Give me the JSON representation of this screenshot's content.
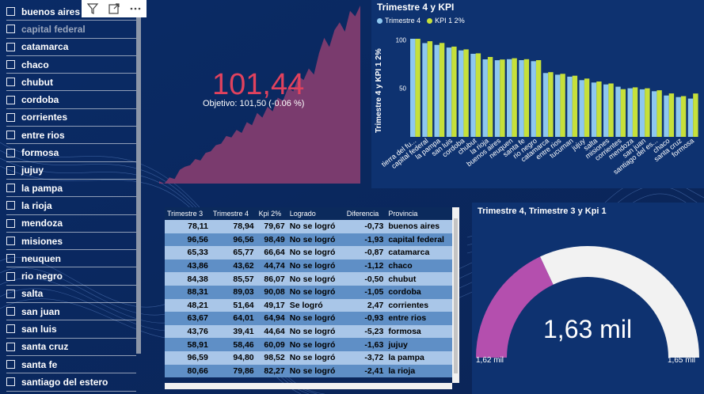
{
  "slicer": {
    "items": [
      {
        "label": "buenos aires",
        "dim": false
      },
      {
        "label": "capital federal",
        "dim": true
      },
      {
        "label": "catamarca",
        "dim": false
      },
      {
        "label": "chaco",
        "dim": false
      },
      {
        "label": "chubut",
        "dim": false
      },
      {
        "label": "cordoba",
        "dim": false
      },
      {
        "label": "corrientes",
        "dim": false
      },
      {
        "label": "entre rios",
        "dim": false
      },
      {
        "label": "formosa",
        "dim": false
      },
      {
        "label": "jujuy",
        "dim": false
      },
      {
        "label": "la pampa",
        "dim": false
      },
      {
        "label": "la rioja",
        "dim": false
      },
      {
        "label": "mendoza",
        "dim": false
      },
      {
        "label": "misiones",
        "dim": false
      },
      {
        "label": "neuquen",
        "dim": false
      },
      {
        "label": "rio negro",
        "dim": false
      },
      {
        "label": "salta",
        "dim": false
      },
      {
        "label": "san juan",
        "dim": false
      },
      {
        "label": "san luis",
        "dim": false
      },
      {
        "label": "santa cruz",
        "dim": false
      },
      {
        "label": "santa fe",
        "dim": false
      },
      {
        "label": "santiago del estero",
        "dim": false
      }
    ],
    "icons": [
      "filter-icon",
      "focus-mode-icon",
      "more-options-icon"
    ]
  },
  "kpi": {
    "value": "101,44",
    "tick": "!",
    "goal_text": "Objetivo: 101,50 (-0.06 %)",
    "area_color": "#7a3b6e",
    "value_color": "#e0425e"
  },
  "chart_data": [
    {
      "type": "bar",
      "title": "Trimestre 4 y KPI",
      "ylabel": "Trimestre 4 y KPI 1 2%",
      "legend": [
        "Trimestre 4",
        "KPI 1 2%"
      ],
      "legend_position": "top-left",
      "colors": [
        "#8ec8f0",
        "#c6e03a"
      ],
      "ylim": [
        0,
        110
      ],
      "yticks": [
        50,
        100
      ],
      "categories": [
        "tierra del fu...",
        "capital federal",
        "la pampa",
        "san luis",
        "cordoba",
        "chubut",
        "la rioja",
        "buenos aires",
        "neuquen",
        "santa fe",
        "rio negro",
        "catamarca",
        "entre rios",
        "tucuman",
        "jujuy",
        "salta",
        "misiones",
        "corrientes",
        "mendoza",
        "san juan",
        "santiago del es...",
        "chaco",
        "santa cruz",
        "formosa"
      ],
      "series": [
        {
          "name": "Trimestre 4",
          "values": [
            101,
            96.56,
            94.8,
            92,
            89.03,
            85.57,
            79.86,
            78.94,
            80,
            79,
            78,
            65.77,
            64.01,
            62,
            58.46,
            56,
            54,
            51.64,
            50,
            49,
            47,
            42.62,
            41,
            39.41
          ]
        },
        {
          "name": "KPI 1 2%",
          "values": [
            101,
            98.49,
            96.69,
            93,
            90.08,
            86.07,
            82.27,
            79.67,
            81,
            80,
            79,
            66.64,
            64.94,
            63,
            60.09,
            57,
            55,
            49.17,
            51,
            50,
            48,
            44.74,
            42,
            44.64
          ]
        }
      ]
    },
    {
      "type": "area",
      "title": "",
      "ylabel": "",
      "series": [
        {
          "name": "",
          "values": [
            3,
            0,
            8,
            6,
            18,
            22,
            24,
            32,
            30,
            40,
            42,
            50,
            52,
            62,
            60,
            70,
            66,
            80,
            76,
            92,
            86,
            100,
            94,
            112,
            108,
            125,
            120,
            140,
            135,
            150,
            142,
            170,
            190,
            178,
            200,
            210,
            198,
            225,
            218,
            232
          ]
        }
      ]
    },
    {
      "type": "gauge",
      "title": "Trimestre 4, Trimestre 3 y Kpi 1",
      "value_label": "1,63 mil",
      "min_label": "1,62 mil",
      "max_label": "1,65 mil",
      "fill_fraction": 0.36,
      "colors": [
        "#b44fae",
        "#f2f2f2"
      ]
    }
  ],
  "table": {
    "columns": [
      "Trimestre 3",
      "Trimestre 4",
      "Kpi 2%",
      "Logrado",
      "Diferencia",
      "Provincia"
    ],
    "rows": [
      [
        "78,11",
        "78,94",
        "79,67",
        "No se logró",
        "-0,73",
        "buenos aires"
      ],
      [
        "96,56",
        "96,56",
        "98,49",
        "No se logró",
        "-1,93",
        "capital federal"
      ],
      [
        "65,33",
        "65,77",
        "66,64",
        "No se logró",
        "-0,87",
        "catamarca"
      ],
      [
        "43,86",
        "43,62",
        "44,74",
        "No se logró",
        "-1,12",
        "chaco"
      ],
      [
        "84,38",
        "85,57",
        "86,07",
        "No se logró",
        "-0,50",
        "chubut"
      ],
      [
        "88,31",
        "89,03",
        "90,08",
        "No se logró",
        "-1,05",
        "cordoba"
      ],
      [
        "48,21",
        "51,64",
        "49,17",
        "Se logró",
        "2,47",
        "corrientes"
      ],
      [
        "63,67",
        "64,01",
        "64,94",
        "No se logró",
        "-0,93",
        "entre rios"
      ],
      [
        "43,76",
        "39,41",
        "44,64",
        "No se logró",
        "-5,23",
        "formosa"
      ],
      [
        "58,91",
        "58,46",
        "60,09",
        "No se logró",
        "-1,63",
        "jujuy"
      ],
      [
        "96,59",
        "94,80",
        "98,52",
        "No se logró",
        "-3,72",
        "la pampa"
      ],
      [
        "80,66",
        "79,86",
        "82,27",
        "No se logró",
        "-2,41",
        "la rioja"
      ]
    ]
  }
}
